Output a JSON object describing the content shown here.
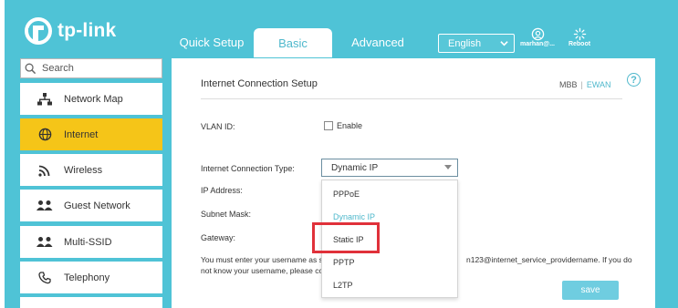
{
  "brand": {
    "logo_text": "tp-link"
  },
  "tabs": [
    {
      "label": "Quick Setup",
      "active": false
    },
    {
      "label": "Basic",
      "active": true
    },
    {
      "label": "Advanced",
      "active": false
    }
  ],
  "header": {
    "language": "English",
    "user_label": "marhan@...",
    "reboot_label": "Reboot"
  },
  "sidebar": {
    "search_placeholder": "Search",
    "items": [
      {
        "label": "Network Map",
        "icon": "network-map-icon",
        "active": false
      },
      {
        "label": "Internet",
        "icon": "globe-icon",
        "active": true
      },
      {
        "label": "Wireless",
        "icon": "wifi-icon",
        "active": false
      },
      {
        "label": "Guest Network",
        "icon": "guest-network-icon",
        "active": false
      },
      {
        "label": "Multi-SSID",
        "icon": "multi-ssid-icon",
        "active": false
      },
      {
        "label": "Telephony",
        "icon": "phone-icon",
        "active": false
      }
    ]
  },
  "main": {
    "title": "Internet Connection Setup",
    "mode_mbb": "MBB",
    "mode_sep": "|",
    "mode_ewan": "EWAN",
    "vlan_label": "VLAN ID:",
    "vlan_enable_label": "Enable",
    "vlan_enabled": false,
    "conn_type_label": "Internet Connection Type:",
    "conn_type_value": "Dynamic IP",
    "ip_label": "IP Address:",
    "subnet_label": "Subnet Mask:",
    "gateway_label": "Gateway:",
    "dropdown_options": [
      {
        "label": "PPPoE",
        "selected": false
      },
      {
        "label": "Dynamic IP",
        "selected": true
      },
      {
        "label": "Static IP",
        "selected": false
      },
      {
        "label": "PPTP",
        "selected": false
      },
      {
        "label": "L2TP",
        "selected": false
      }
    ],
    "note_line1_a": "You must enter your username as s",
    "note_line1_b": "n123@internet_service_providername. If you do",
    "note_line2": "not know your username, please co",
    "save_label": "save"
  },
  "colors": {
    "frame_bg": "#4fc3d6",
    "accent": "#4fb8cc",
    "active_nav": "#f5c518",
    "highlight_box": "#e0313a",
    "save_button": "#6fcde0"
  }
}
